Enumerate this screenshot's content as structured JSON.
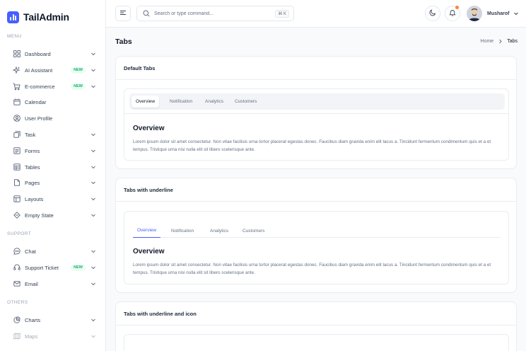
{
  "brand": {
    "name": "TailAdmin",
    "color": "#465fff"
  },
  "sidebar": {
    "sections": [
      {
        "label": "MENU",
        "items": [
          {
            "label": "Dashboard",
            "icon": "grid-icon",
            "chevron": true
          },
          {
            "label": "AI Assistant",
            "icon": "sparkle-icon",
            "badge": "NEW",
            "chevron": true
          },
          {
            "label": "E-commerce",
            "icon": "cart-icon",
            "badge": "NEW",
            "chevron": true
          },
          {
            "label": "Calendar",
            "icon": "calendar-icon"
          },
          {
            "label": "User Profile",
            "icon": "user-circle-icon"
          },
          {
            "label": "Task",
            "icon": "task-icon",
            "chevron": true
          },
          {
            "label": "Forms",
            "icon": "form-icon",
            "chevron": true
          },
          {
            "label": "Tables",
            "icon": "table-icon",
            "chevron": true
          },
          {
            "label": "Pages",
            "icon": "page-icon",
            "chevron": true
          },
          {
            "label": "Layouts",
            "icon": "layout-icon",
            "chevron": true
          },
          {
            "label": "Empty State",
            "icon": "diamond-icon",
            "chevron": true
          }
        ]
      },
      {
        "label": "SUPPORT",
        "items": [
          {
            "label": "Chat",
            "icon": "chat-icon",
            "chevron": true
          },
          {
            "label": "Support Ticket",
            "icon": "headset-icon",
            "badge": "NEW",
            "chevron": true
          },
          {
            "label": "Email",
            "icon": "mail-icon",
            "chevron": true
          }
        ]
      },
      {
        "label": "OTHERS",
        "items": [
          {
            "label": "Charts",
            "icon": "pie-chart-icon",
            "chevron": true
          },
          {
            "label": "Maps",
            "icon": "map-icon",
            "chevron": true
          }
        ]
      }
    ]
  },
  "header": {
    "search_placeholder": "Search or type command...",
    "shortcut": "⌘ K",
    "user_name": "Musharof"
  },
  "page": {
    "title": "Tabs",
    "breadcrumb": {
      "home": "Home",
      "current": "Tabs"
    }
  },
  "cards": {
    "default": {
      "title": "Default Tabs",
      "tabs": [
        "Overview",
        "Notification",
        "Analytics",
        "Customers"
      ],
      "active": 0,
      "content_title": "Overview",
      "content_text": "Lorem ipsum dolor sit amet consectetur. Non vitae facilisis urna tortor placerat egestas donec. Faucibus diam gravida enim elit lacus a. Tincidunt fermentum condimentum quis et a et tempus. Tristique urna nisi nulla elit sit libero scelerisque ante."
    },
    "underline": {
      "title": "Tabs with underline",
      "tabs": [
        "Overview",
        "Notification",
        "Analytics",
        "Customers"
      ],
      "active": 0,
      "content_title": "Overview",
      "content_text": "Lorem ipsum dolor sit amet consectetur. Non vitae facilisis urna tortor placerat egestas donec. Faucibus diam gravida enim elit lacus a. Tincidunt fermentum condimentum quis et a et tempus. Tristique urna nisi nulla elit sit libero scelerisque ante."
    },
    "underline_icon": {
      "title": "Tabs with underline and icon"
    }
  }
}
